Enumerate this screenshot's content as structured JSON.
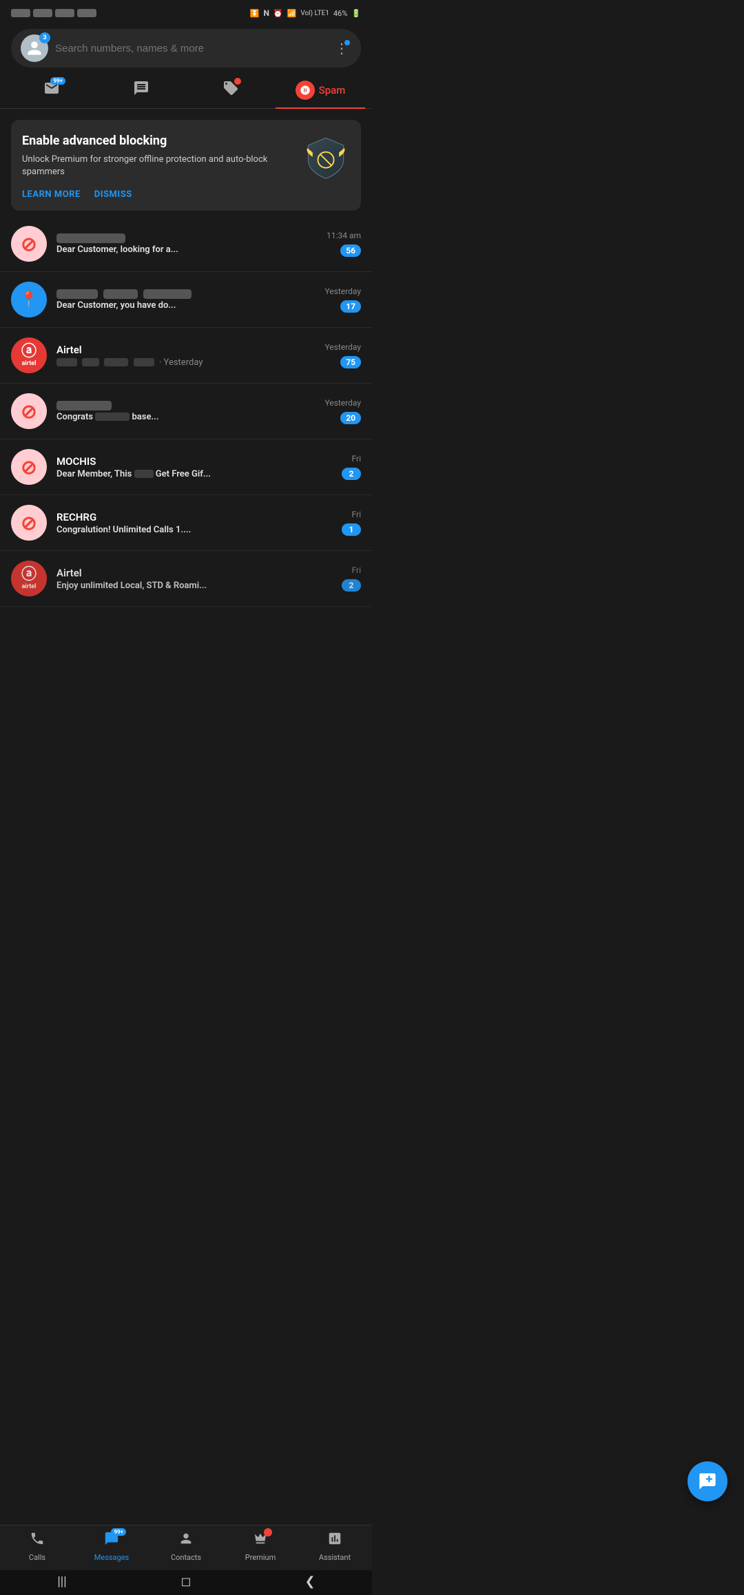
{
  "statusBar": {
    "time": "",
    "battery": "46%",
    "signal": "Vol) LTE1",
    "wifi": true
  },
  "searchBar": {
    "placeholder": "Search numbers, names & more",
    "avatarBadge": "3"
  },
  "tabs": [
    {
      "id": "inbox",
      "icon": "📷",
      "badge": "99+",
      "badgeType": "blue",
      "active": false
    },
    {
      "id": "sms",
      "icon": "🗒",
      "badge": "",
      "badgeType": "",
      "active": false
    },
    {
      "id": "tagged",
      "icon": "🏷",
      "badge": "●",
      "badgeType": "red",
      "active": false
    },
    {
      "id": "spam",
      "label": "Spam",
      "icon": "🚫",
      "active": true
    }
  ],
  "banner": {
    "title": "Enable advanced blocking",
    "description": "Unlock Premium for stronger offline protection and auto-block spammers",
    "learnMore": "LEARN MORE",
    "dismiss": "DISMISS"
  },
  "messages": [
    {
      "id": 1,
      "avatarType": "blocked",
      "senderBlurred": true,
      "senderWidth": 100,
      "preview": "Dear Customer, looking for a...",
      "time": "11:34 am",
      "count": "56"
    },
    {
      "id": 2,
      "avatarType": "blue",
      "avatarIcon": "📍",
      "senderBlurred": true,
      "senderWidth": 180,
      "preview": "Dear Customer, you have do...",
      "time": "Yesterday",
      "count": "17"
    },
    {
      "id": 3,
      "avatarType": "airtel",
      "sender": "Airtel",
      "previewBlurred": true,
      "previewBlurWidth": 140,
      "time": "Yesterday",
      "count": "75"
    },
    {
      "id": 4,
      "avatarType": "blocked",
      "senderBlurred": true,
      "senderWidth": 80,
      "preview": "Congrats",
      "previewSuffix": " base...",
      "previewBlurred": true,
      "previewBlurWidth": 60,
      "time": "Yesterday",
      "count": "20"
    },
    {
      "id": 5,
      "avatarType": "blocked",
      "sender": "MOCHIS",
      "preview": "Dear Member, This",
      "previewSuffix": " Get Free Gif...",
      "previewBlurred": true,
      "previewBlurWidth": 30,
      "time": "Fri",
      "count": "2"
    },
    {
      "id": 6,
      "avatarType": "blocked",
      "sender": "RECHRG",
      "preview": "Congralution! Unlimited Calls 1....",
      "time": "Fri",
      "count": "1"
    },
    {
      "id": 7,
      "avatarType": "airtel2",
      "sender": "Airtel",
      "preview": "Enjoy unlimited Local, STD & Roami...",
      "time": "Fri",
      "count": "2"
    }
  ],
  "fab": {
    "icon": "chat-plus"
  },
  "bottomNav": [
    {
      "id": "calls",
      "label": "Calls",
      "icon": "📞",
      "active": false,
      "badge": ""
    },
    {
      "id": "messages",
      "label": "Messages",
      "icon": "💬",
      "active": true,
      "badge": "99+"
    },
    {
      "id": "contacts",
      "label": "Contacts",
      "icon": "👤",
      "active": false,
      "badge": ""
    },
    {
      "id": "premium",
      "label": "Premium",
      "icon": "👑",
      "active": false,
      "badgeRed": true
    },
    {
      "id": "assistant",
      "label": "Assistant",
      "icon": "📊",
      "active": false,
      "badge": ""
    }
  ],
  "sysNav": {
    "back": "❮",
    "home": "◻",
    "recents": "|||"
  }
}
